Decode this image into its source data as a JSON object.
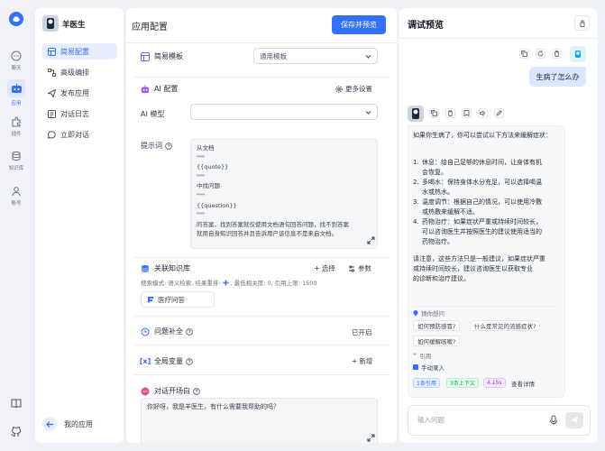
{
  "rail": {
    "items": [
      {
        "label": "聊天",
        "icon": "chat-icon"
      },
      {
        "label": "应用",
        "icon": "app-icon",
        "active": true
      },
      {
        "label": "插件",
        "icon": "plugin-icon"
      },
      {
        "label": "知识库",
        "icon": "database-icon"
      },
      {
        "label": "账号",
        "icon": "user-icon"
      }
    ],
    "bottom_icons": [
      "book-icon",
      "github-icon"
    ]
  },
  "app": {
    "name": "羊医生",
    "nav": [
      {
        "label": "简易配置",
        "icon": "grid-icon",
        "active": true
      },
      {
        "label": "高级编排",
        "icon": "flow-icon"
      },
      {
        "label": "发布应用",
        "icon": "send-icon"
      },
      {
        "label": "对话日志",
        "icon": "log-icon"
      },
      {
        "label": "立即对话",
        "icon": "chat-bubble-icon"
      }
    ],
    "back_label": "我的应用"
  },
  "config": {
    "title": "应用配置",
    "save_label": "保存并预览",
    "template_label": "简易模板",
    "template_value": "通用模板",
    "ai_config_label": "AI 配置",
    "more_settings_label": "更多设置",
    "model_label": "AI 模型",
    "model_value": "",
    "prompt_label": "提示词",
    "prompt_text": "从文档\n\"\"\"\n{{quote}}\n\"\"\"\n中找问题\n\"\"\"\n{{question}}\n\"\"\"\n的答案，找到答案就仅使用文档语句回答问题，找不到答案\n就用自身知识回答并且告诉用户该信息不是来自文档。",
    "kb_label": "关联知识库",
    "kb_select_label": "选择",
    "kb_params_label": "参数",
    "kb_info": "搜索模式: 语义检索, 结果重排: ",
    "kb_info_tail": ", 最低相关度: 0, 引用上限: 1500",
    "kb_item": "医疗问答",
    "question_guide_label": "问题补全",
    "question_guide_status": "已开启",
    "global_var_label": "全局变量",
    "global_var_add": "新增",
    "welcome_label": "对话开场白",
    "welcome_text": "你好呀，我是羊医生，有什么需要我帮助的吗？"
  },
  "preview": {
    "title": "调试预览",
    "user_message": "生病了怎么办",
    "assistant_message": {
      "intro": "如果你生病了，你可以尝试以下方法来缓解症状：",
      "items": [
        {
          "n": "1.",
          "line1": "休息：给自己足够的休息时间，让身体有机",
          "line2": "会恢复。"
        },
        {
          "n": "2.",
          "line1": "多喝水：保持身体水分充足，可以选择喝温",
          "line2": "水或热水。"
        },
        {
          "n": "3.",
          "line1": "温度调节：根据自己的情况，可以使用冷敷",
          "line2": "或热敷来缓解不适。"
        },
        {
          "n": "4.",
          "line1": "药物治疗：如果症状严重或持续时间较长，",
          "line2": "可以咨询医生并按照医生的建议使用适当的",
          "line3": "药物治疗。"
        }
      ],
      "outro": [
        "请注意，这些方法只是一般建议，如果症状严重",
        "或持续时间较长，建议咨询医生以获取专业",
        "的诊断和治疗建议。"
      ]
    },
    "guess_label": "猜你想问",
    "suggested_questions": [
      "如何预防感冒?",
      "什么是常见的流感症状?",
      "如何缓解咳嗽?"
    ],
    "quote_label": "引用",
    "quote_source": "手动录入",
    "tags": [
      "1条引用",
      "3条上下文",
      "4.15s"
    ],
    "details_label": "查看详情",
    "input_placeholder": "输入问题",
    "colors": {
      "accent": "#3370ff",
      "user_bubble": "#dbe6ff",
      "green": "#16a34a",
      "purple": "#9333ea"
    }
  }
}
